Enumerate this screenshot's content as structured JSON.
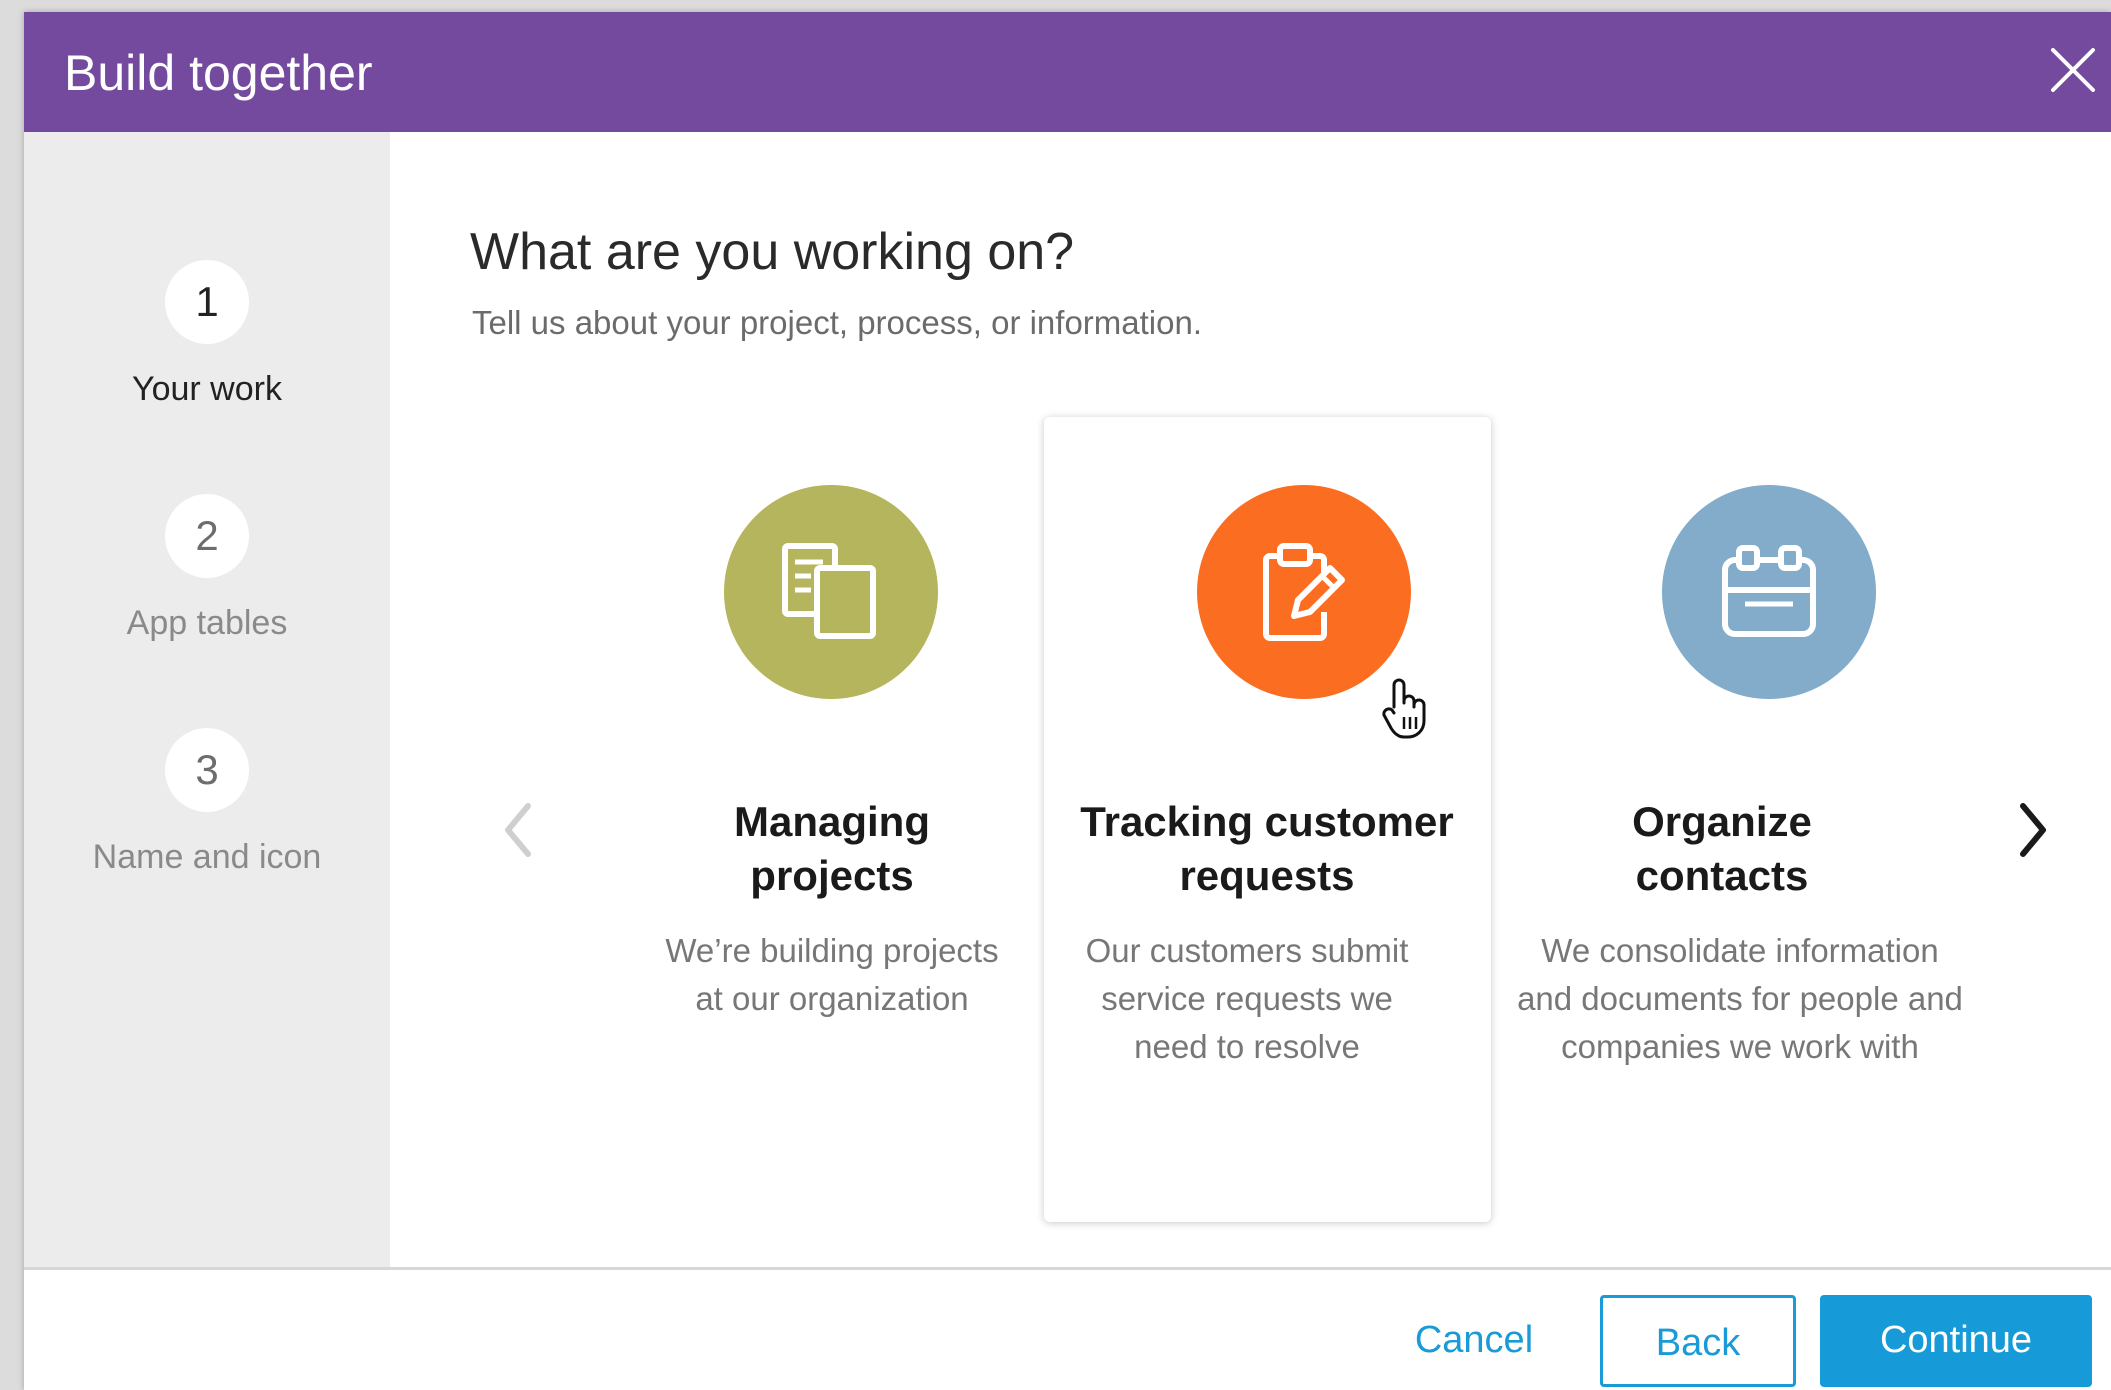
{
  "dialog": {
    "title": "Build together",
    "close_icon": "close-icon"
  },
  "steps": [
    {
      "number": "1",
      "label": "Your work",
      "active": true
    },
    {
      "number": "2",
      "label": "App tables",
      "active": false
    },
    {
      "number": "3",
      "label": "Name and icon",
      "active": false
    }
  ],
  "main": {
    "heading": "What are you working on?",
    "subheading": "Tell us about your project, process, or information."
  },
  "options": [
    {
      "title_line1": "Managing",
      "title_line2": "projects",
      "desc_line1": "We’re building projects",
      "desc_line2": "at our organization",
      "desc_line3": "",
      "icon": "documents-icon",
      "color": "#b4b55d",
      "selected": false
    },
    {
      "title_line1": "Tracking customer",
      "title_line2": "requests",
      "desc_line1": "Our customers submit",
      "desc_line2": "service requests we",
      "desc_line3": "need to resolve",
      "icon": "clipboard-edit-icon",
      "color": "#fb6d21",
      "selected": true
    },
    {
      "title_line1": "Organize",
      "title_line2": "contacts",
      "desc_line1": "We consolidate information",
      "desc_line2": "and documents for people and",
      "desc_line3": "companies we work with",
      "icon": "contact-card-icon",
      "color": "#82acca",
      "selected": false
    }
  ],
  "carousel": {
    "prev_icon": "chevron-left-icon",
    "next_icon": "chevron-right-icon"
  },
  "footer": {
    "cancel_label": "Cancel",
    "back_label": "Back",
    "continue_label": "Continue"
  },
  "colors": {
    "header": "#744a9e",
    "accent": "#169bd8",
    "sidebar": "#ececec"
  }
}
